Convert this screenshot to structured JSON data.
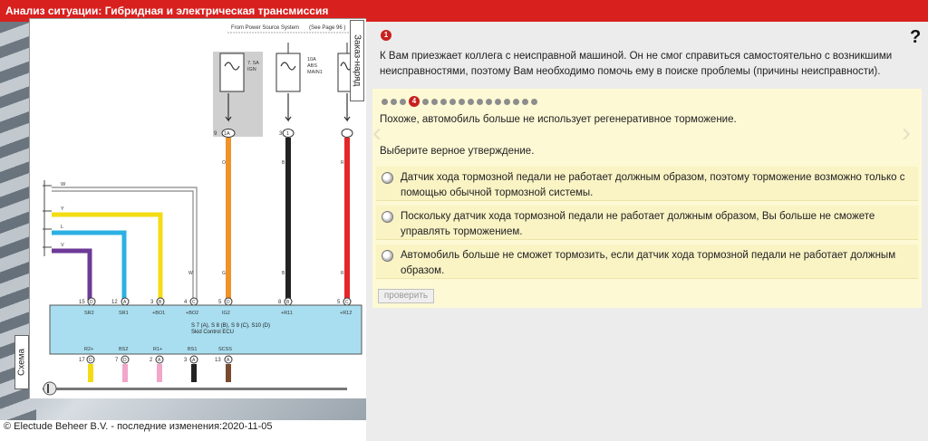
{
  "window": {
    "title": "Анализ ситуации: Гибридная и электрическая трансмиссия"
  },
  "help_icon": "question-mark-icon",
  "tabs": {
    "order": "Заказ-наряд",
    "scheme": "Схема"
  },
  "diagram": {
    "source": "From Power Source System",
    "see_page": "(See Page 96 )",
    "fuse1": [
      "7. 5A",
      "IGN"
    ],
    "fuse2": [
      "10A",
      "ABS",
      "MAIN1"
    ],
    "pins_top": [
      {
        "n": "15",
        "l": "D",
        "name": "SR2"
      },
      {
        "n": "12",
        "l": "A",
        "name": "SR1"
      },
      {
        "n": "3",
        "l": "B",
        "name": "+BO1"
      },
      {
        "n": "4",
        "l": "C",
        "name": "+BO2"
      },
      {
        "n": "5",
        "l": "D",
        "name": "IG2"
      },
      {
        "n": "8",
        "l": "B",
        "name": "+R11"
      },
      {
        "n": "5",
        "l": "C",
        "name": "+R12"
      }
    ],
    "pins_bottom": [
      {
        "n": "17",
        "l": "D",
        "name": "R2+"
      },
      {
        "n": "7",
        "l": "D",
        "name": "BS2"
      },
      {
        "n": "2",
        "l": "A",
        "name": "R1+"
      },
      {
        "n": "3",
        "l": "A",
        "name": "BS1"
      },
      {
        "n": "13",
        "l": "A",
        "name": "SCSS"
      }
    ],
    "connector_top": [
      "9",
      "1A",
      "3",
      "1"
    ],
    "wire_letters": [
      "W",
      "Y",
      "L",
      "V",
      "O",
      "B",
      "R",
      "W",
      "G",
      "B",
      "R"
    ],
    "ecu_line1": "S 7 (A), S 8 (B), S 9 (C), S10 (D)",
    "ecu_line2": "Skid Control ECU"
  },
  "footer": {
    "text": "© Electude Beheer B.V. - последние изменения:2020-11-05"
  },
  "step_number": "1",
  "intro_text": "К Вам приезжает коллега с неисправной машиной. Он не смог справиться самостоятельно с возникшими неисправностями, поэтому Вам необходимо помочь ему в поиске проблемы (причины неисправности).",
  "quiz": {
    "current": "4",
    "total_dots": 17,
    "question": "Похоже, автомобиль больше не использует регенеративное торможение.",
    "prompt": "Выберите верное утверждение.",
    "options": [
      "Датчик хода тормозной педали не работает должным образом, поэтому торможение возможно только с помощью обычной тормозной системы.",
      "Поскольку датчик хода тормозной педали не работает должным образом, Вы больше не сможете управлять торможением.",
      "Автомобиль больше не сможет тормозить, если датчик хода тормозной педали не работает должным образом."
    ],
    "check_button": "проверить"
  }
}
